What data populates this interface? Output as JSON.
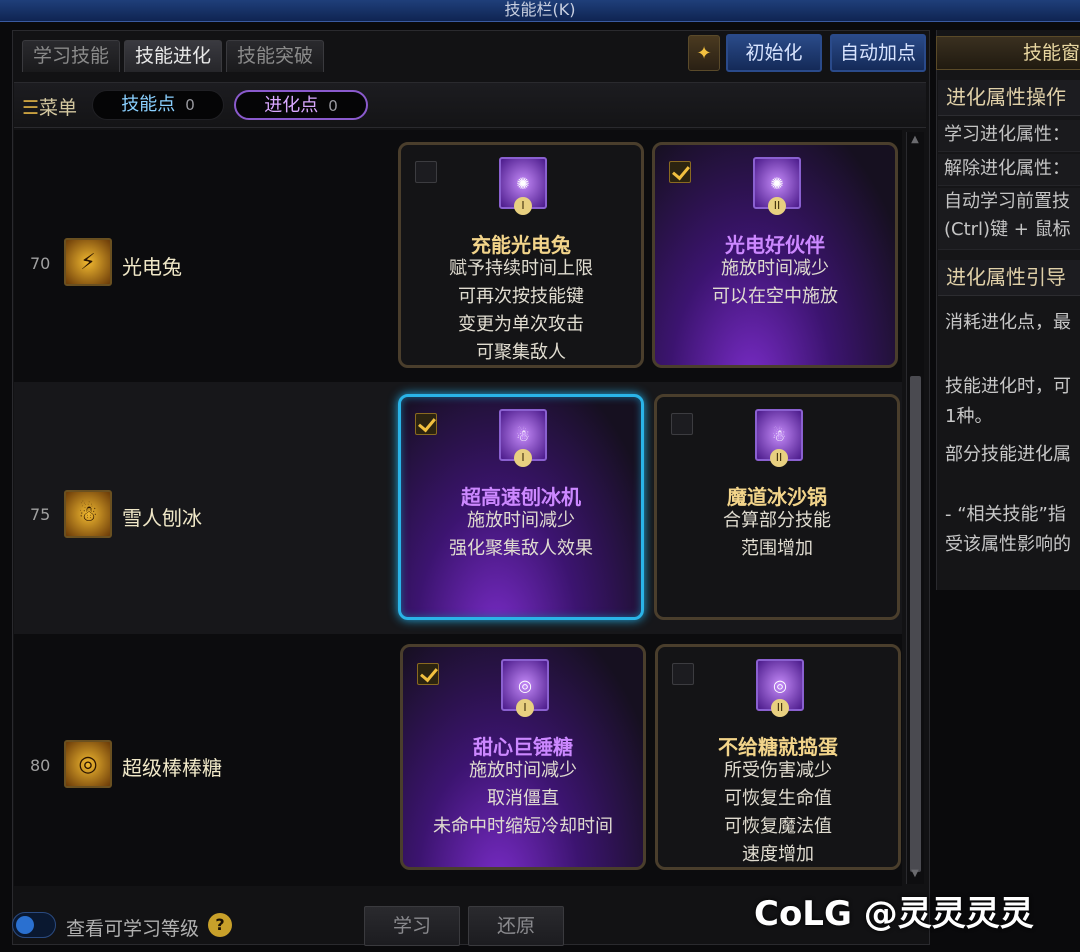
{
  "window_title": "技能栏(K)",
  "tabs": [
    "学习技能",
    "技能进化",
    "技能突破"
  ],
  "header_buttons": {
    "init": "初始化",
    "auto": "自动加点",
    "icon": "skill-book-icon"
  },
  "toolbar": {
    "menu": "菜单",
    "skill_points_label": "技能点",
    "skill_points": "0",
    "evo_points_label": "进化点",
    "evo_points": "0"
  },
  "skills": [
    {
      "level": "70",
      "name": "光电兔",
      "icon": "lightning-rabbit-icon",
      "evolutions": [
        {
          "name": "充能光电兔",
          "tier": "I",
          "checked": false,
          "lines": [
            "赋予持续时间上限",
            "可再次按技能键",
            "变更为单次攻击",
            "可聚集敌人"
          ]
        },
        {
          "name": "光电好伙伴",
          "tier": "II",
          "checked": true,
          "lines": [
            "施放时间减少",
            "可以在空中施放"
          ]
        }
      ]
    },
    {
      "level": "75",
      "name": "雪人刨冰",
      "icon": "snowman-shaved-ice-icon",
      "evolutions": [
        {
          "name": "超高速刨冰机",
          "tier": "I",
          "checked": true,
          "lines": [
            "施放时间减少",
            "强化聚集敌人效果"
          ]
        },
        {
          "name": "魔道冰沙锅",
          "tier": "II",
          "checked": false,
          "lines": [
            "合算部分技能",
            "范围增加"
          ]
        }
      ]
    },
    {
      "level": "80",
      "name": "超级棒棒糖",
      "icon": "lollipop-icon",
      "evolutions": [
        {
          "name": "甜心巨锤糖",
          "tier": "I",
          "checked": true,
          "lines": [
            "施放时间减少",
            "取消僵直",
            "未命中时缩短冷却时间"
          ]
        },
        {
          "name": "不给糖就捣蛋",
          "tier": "II",
          "checked": false,
          "lines": [
            "所受伤害减少",
            "可恢复生命值",
            "可恢复魔法值",
            "速度增加"
          ]
        }
      ]
    }
  ],
  "footer": {
    "toggle_label": "查看可学习等级",
    "help": "?",
    "learn": "学习",
    "restore": "还原"
  },
  "side_panel": {
    "header": "技能窗",
    "section1": "进化属性操作",
    "line1": "学习进化属性：",
    "line2": "解除进化属性：",
    "line3a": "自动学习前置技",
    "line3b": "(Ctrl)键 + 鼠标",
    "section2": "进化属性引导",
    "text1": "消耗进化点，最",
    "text2": "技能进化时，可",
    "text3": "1种。",
    "text4": "部分技能进化属",
    "text5": "- “相关技能”指",
    "text6": "受该属性影响的"
  },
  "watermark": "CoLG @灵灵灵灵"
}
